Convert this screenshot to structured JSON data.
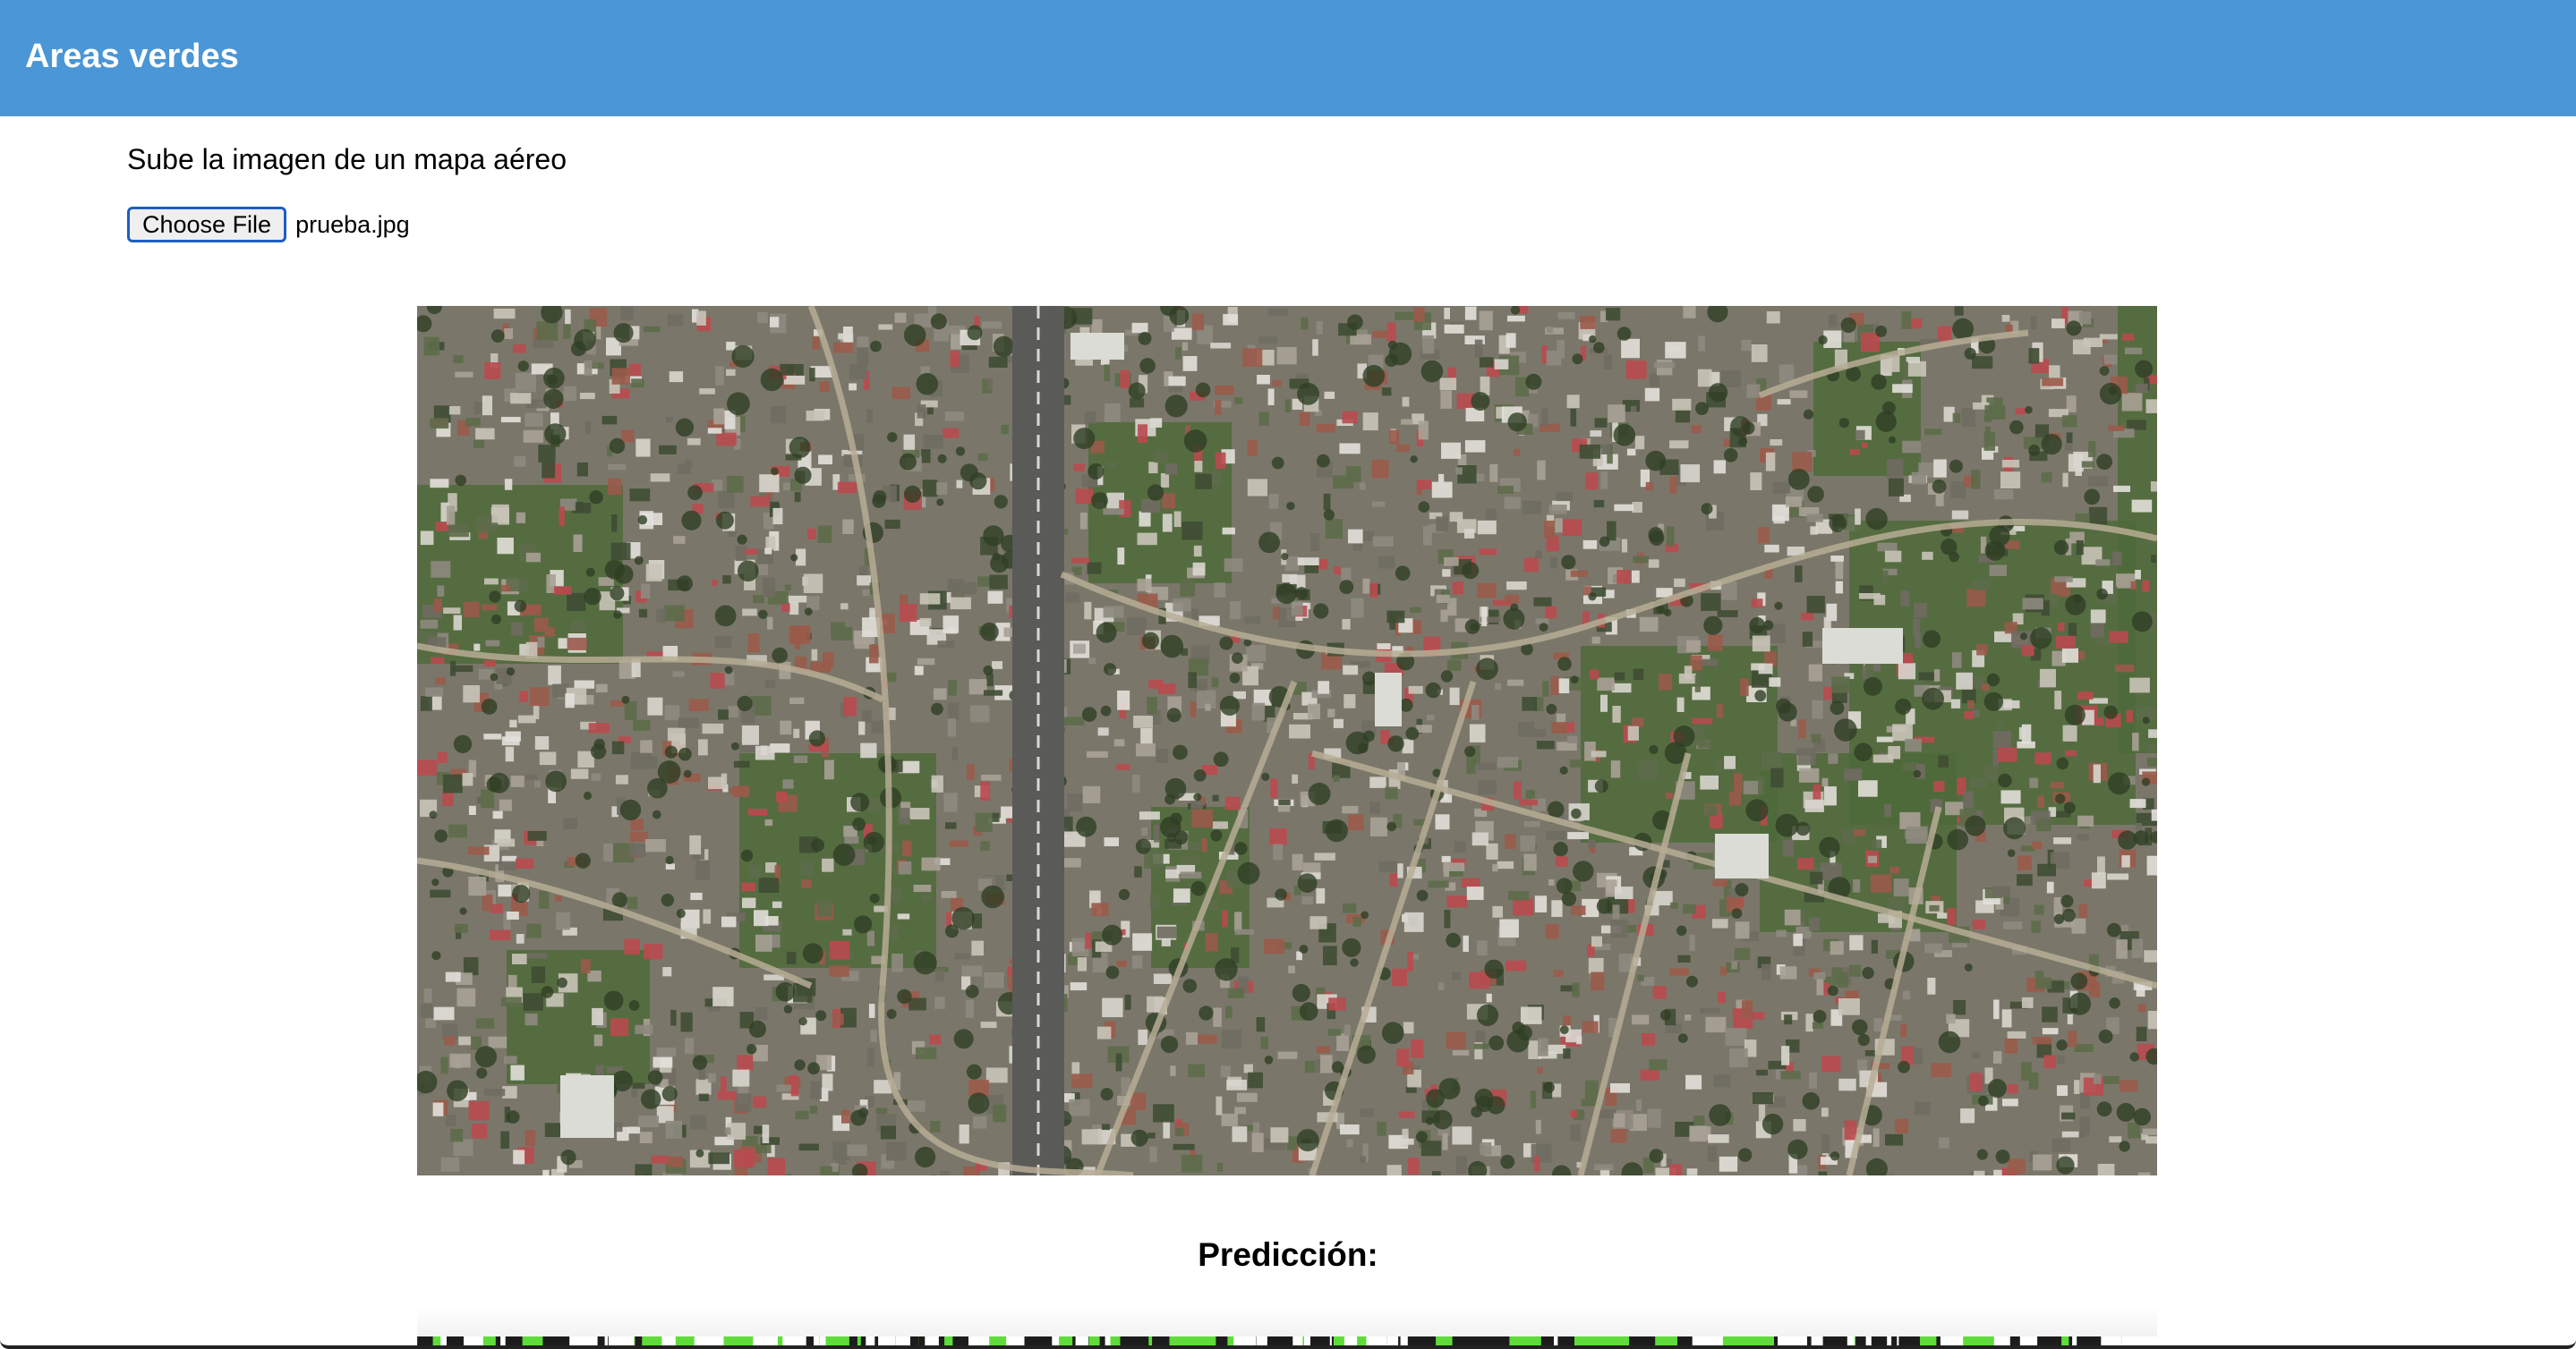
{
  "header": {
    "title": "Areas verdes"
  },
  "upload": {
    "prompt": "Sube la imagen de un mapa aéreo",
    "button_label": "Choose File",
    "file_name": "prueba.jpg"
  },
  "prediction": {
    "title": "Predicción:"
  },
  "colors": {
    "header_bg": "#4a96d6",
    "header_text": "#ffffff",
    "button_border": "#1f5fbf",
    "prediction_green": "#5fdc3a"
  },
  "icons": {
    "aerial_image": "aerial-map-image",
    "prediction_image": "prediction-mask-image"
  }
}
